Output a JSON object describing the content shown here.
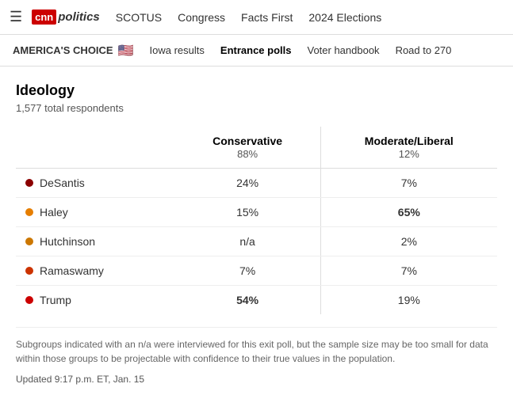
{
  "nav": {
    "hamburger": "☰",
    "cnn_label": "cnn",
    "politics_label": "politics",
    "links": [
      {
        "label": "SCOTUS"
      },
      {
        "label": "Congress"
      },
      {
        "label": "Facts First"
      },
      {
        "label": "2024 Elections"
      }
    ]
  },
  "subnav": {
    "brand": "AMERICA'S CHOICE",
    "flag": "🇺🇸",
    "links": [
      {
        "label": "Iowa results",
        "active": false
      },
      {
        "label": "Entrance polls",
        "active": true
      },
      {
        "label": "Voter handbook",
        "active": false
      },
      {
        "label": "Road to 270",
        "active": false
      }
    ]
  },
  "section": {
    "title": "Ideology",
    "respondents": "1,577 total respondents",
    "columns": [
      {
        "id": "candidate",
        "label": "",
        "sub": ""
      },
      {
        "id": "conservative",
        "label": "Conservative",
        "sub": "88%"
      },
      {
        "id": "moderate",
        "label": "Moderate/Liberal",
        "sub": "12%"
      }
    ],
    "rows": [
      {
        "name": "DeSantis",
        "dot_color": "#8B0000",
        "conservative": "24%",
        "moderate": "7%",
        "mod_highlight": false,
        "con_highlight": false
      },
      {
        "name": "Haley",
        "dot_color": "#e67e00",
        "conservative": "15%",
        "moderate": "65%",
        "mod_highlight": true,
        "con_highlight": false
      },
      {
        "name": "Hutchinson",
        "dot_color": "#cc7700",
        "conservative": "n/a",
        "moderate": "2%",
        "mod_highlight": false,
        "con_highlight": false
      },
      {
        "name": "Ramaswamy",
        "dot_color": "#cc3300",
        "conservative": "7%",
        "moderate": "7%",
        "mod_highlight": false,
        "con_highlight": false
      },
      {
        "name": "Trump",
        "dot_color": "#cc0000",
        "conservative": "54%",
        "moderate": "19%",
        "mod_highlight": false,
        "con_highlight": true
      }
    ],
    "footnote": "Subgroups indicated with an n/a were interviewed for this exit poll, but the sample size may be too small for data within those groups to be projectable with confidence to their true values in the population.",
    "updated": "Updated 9:17 p.m. ET, Jan. 15"
  }
}
